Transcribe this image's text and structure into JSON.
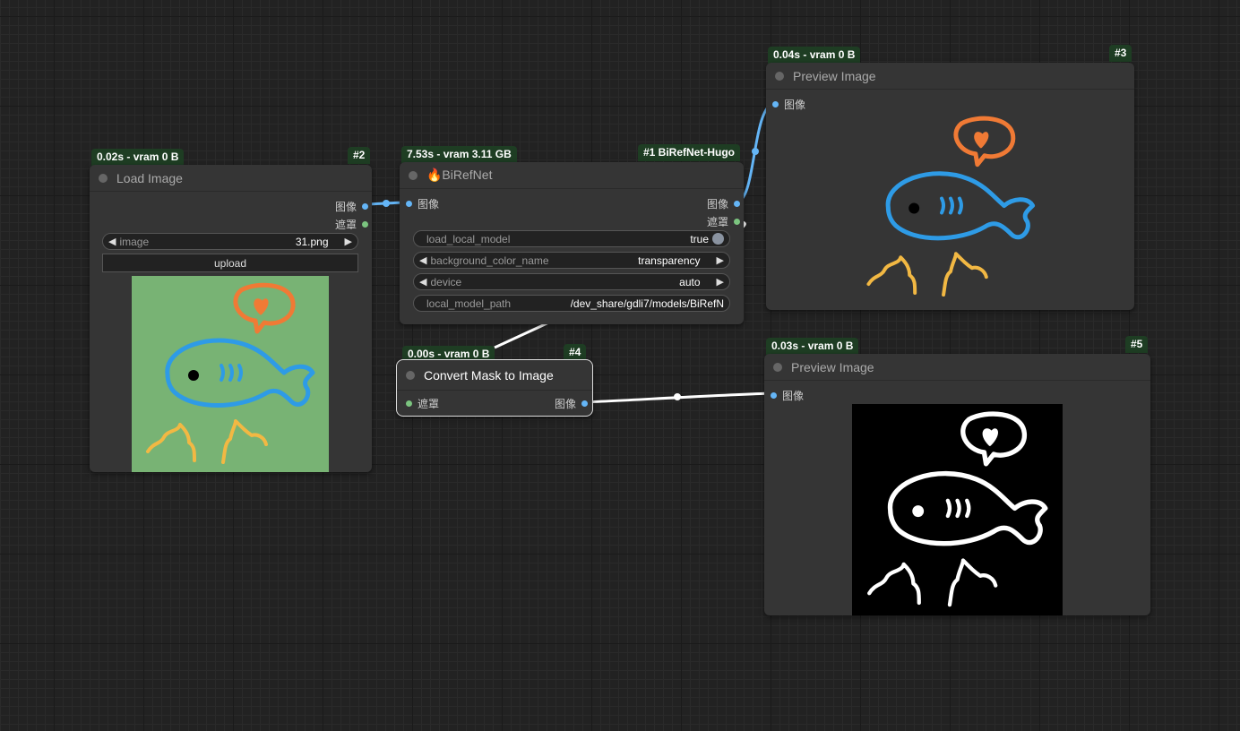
{
  "nodes": {
    "load_image": {
      "badge_time": "0.02s - vram 0 B",
      "badge_id": "#2",
      "title": "Load Image",
      "outputs": [
        "图像",
        "遮罩"
      ],
      "image_widget": {
        "label": "image",
        "value": "31.png"
      },
      "upload_label": "upload"
    },
    "birefnet": {
      "badge_time": "7.53s - vram 3.11 GB",
      "badge_id": "#1 BiRefNet-Hugo",
      "title": "🔥BiRefNet",
      "input": "图像",
      "outputs": [
        "图像",
        "遮罩"
      ],
      "widgets": [
        {
          "label": "load_local_model",
          "value": "true"
        },
        {
          "label": "background_color_name",
          "value": "transparency"
        },
        {
          "label": "device",
          "value": "auto"
        },
        {
          "label": "local_model_path",
          "value": "/dev_share/gdli7/models/BiRefN"
        }
      ]
    },
    "convert_mask": {
      "badge_time": "0.00s - vram 0 B",
      "badge_id": "#4",
      "title": "Convert Mask to Image",
      "input": "遮罩",
      "output": "图像"
    },
    "preview_3": {
      "badge_time": "0.04s - vram 0 B",
      "badge_id": "#3",
      "title": "Preview Image",
      "input": "图像"
    },
    "preview_5": {
      "badge_time": "0.03s - vram 0 B",
      "badge_id": "#5",
      "title": "Preview Image",
      "input": "图像"
    }
  },
  "colors": {
    "canvas": "#222222",
    "node_bg": "#353535",
    "badge_bg": "#1e3d23",
    "image_pin": "#64b5f6",
    "mask_pin": "#7bc47f",
    "fish_blue": "#2e9be6",
    "heart_orange": "#f07a35",
    "squiggle_yellow": "#f2b843",
    "load_preview_bg": "#78b374"
  }
}
